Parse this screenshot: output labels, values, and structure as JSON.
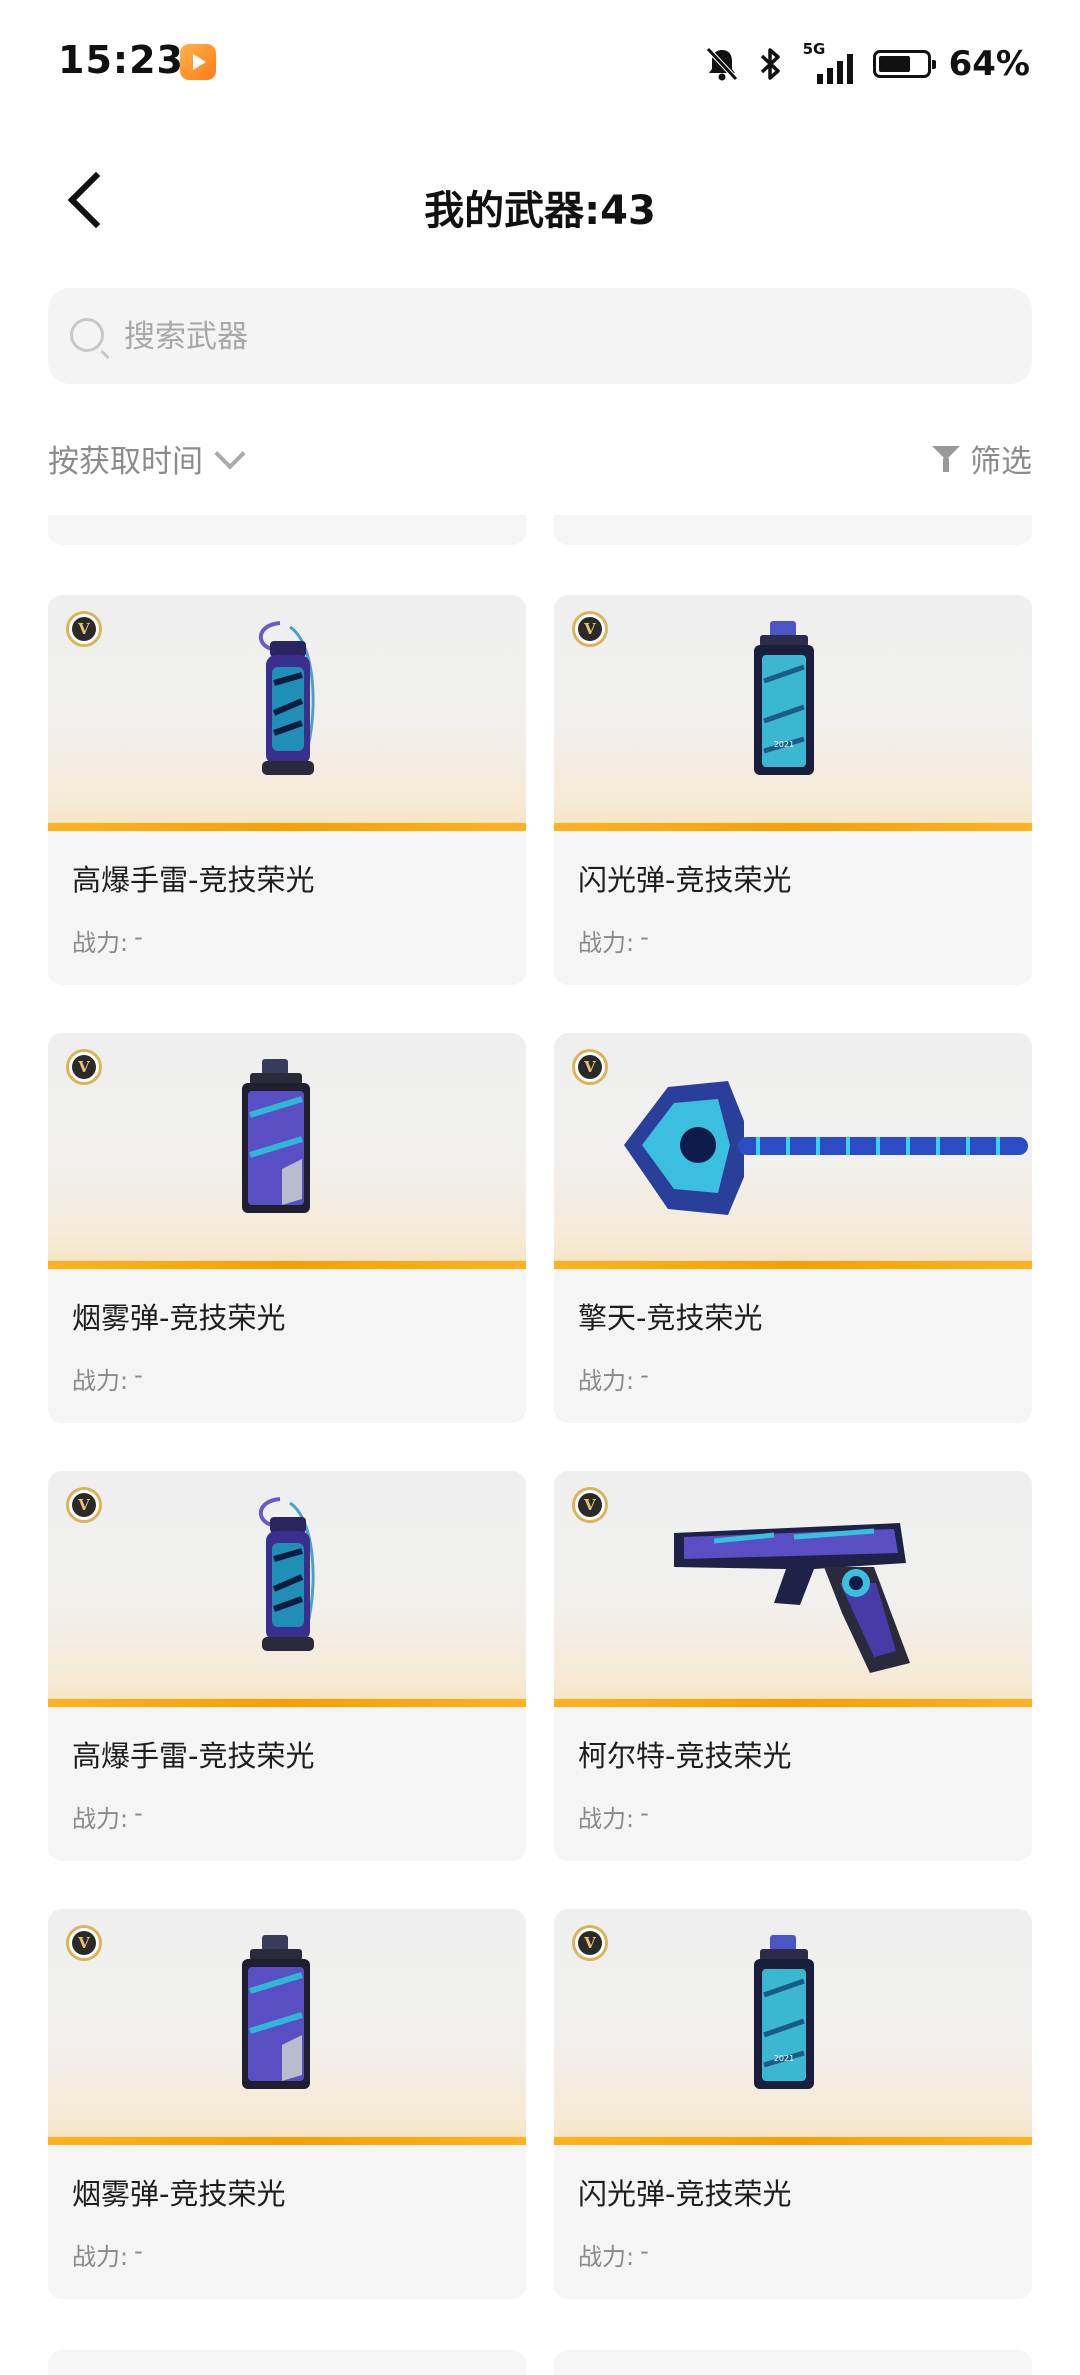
{
  "status_bar": {
    "time": "15:23",
    "network": "5G",
    "battery": "64%",
    "icons": [
      "app-video-icon",
      "bell-muted-icon",
      "bluetooth-icon",
      "signal-5g-icon",
      "battery-icon"
    ]
  },
  "header": {
    "back_icon": "chevron-left-icon",
    "title": "我的武器:43"
  },
  "search": {
    "placeholder": "搜索武器",
    "value": ""
  },
  "toolbar": {
    "sort_label": "按获取时间",
    "filter_label": "筛选"
  },
  "colors": {
    "accent_orange": "#f6a000",
    "card_bg": "#f5f5f5",
    "text_secondary": "#8a8a8a"
  },
  "badge_letter": "V",
  "weapons": [
    {
      "name": "高爆手雷-竞技荣光",
      "power_label": "战力:",
      "power_value": "-",
      "type": "grenade"
    },
    {
      "name": "闪光弹-竞技荣光",
      "power_label": "战力:",
      "power_value": "-",
      "type": "flash"
    },
    {
      "name": "烟雾弹-竞技荣光",
      "power_label": "战力:",
      "power_value": "-",
      "type": "smoke"
    },
    {
      "name": "擎天-竞技荣光",
      "power_label": "战力:",
      "power_value": "-",
      "type": "axe"
    },
    {
      "name": "高爆手雷-竞技荣光",
      "power_label": "战力:",
      "power_value": "-",
      "type": "grenade"
    },
    {
      "name": "柯尔特-竞技荣光",
      "power_label": "战力:",
      "power_value": "-",
      "type": "pistol"
    },
    {
      "name": "烟雾弹-竞技荣光",
      "power_label": "战力:",
      "power_value": "-",
      "type": "smoke"
    },
    {
      "name": "闪光弹-竞技荣光",
      "power_label": "战力:",
      "power_value": "-",
      "type": "flash"
    }
  ]
}
